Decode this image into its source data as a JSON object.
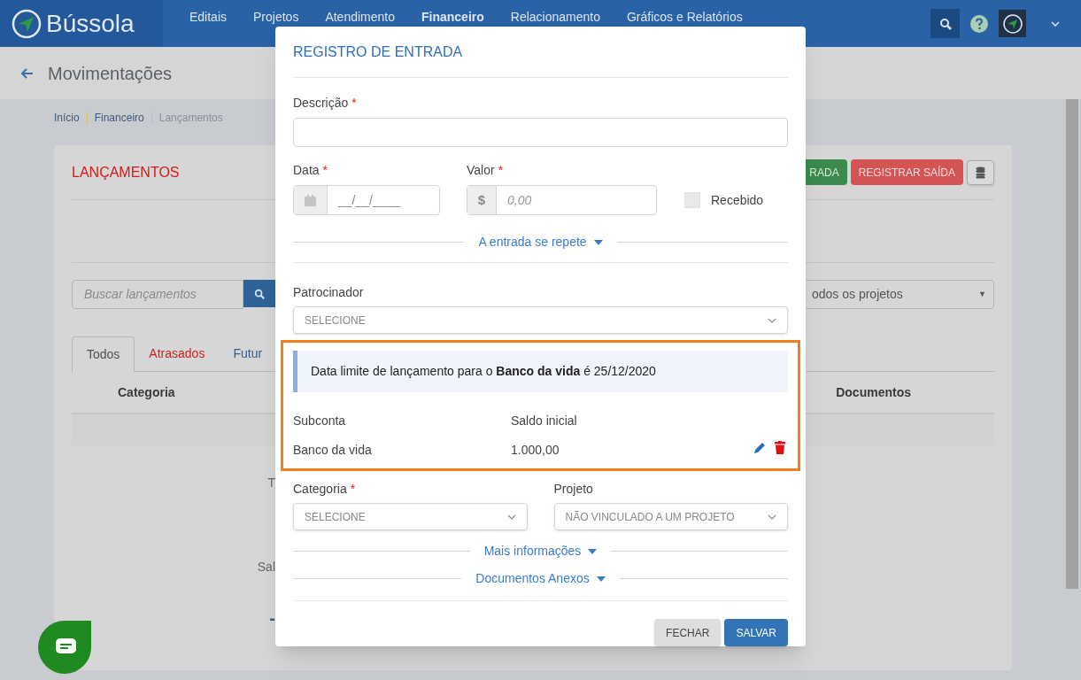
{
  "header": {
    "brand": "Bússola",
    "nav": [
      {
        "label": "Editais",
        "selected": false
      },
      {
        "label": "Projetos",
        "selected": false
      },
      {
        "label": "Atendimento",
        "selected": false
      },
      {
        "label": "Financeiro",
        "selected": true
      },
      {
        "label": "Relacionamento",
        "selected": false
      },
      {
        "label": "Gráficos e Relatórios",
        "selected": false
      }
    ]
  },
  "page_title": "Movimentações",
  "breadcrumb": [
    "Início",
    "Financeiro",
    "Lançamentos"
  ],
  "card": {
    "title": "LANÇAMENTOS",
    "buttons": [
      {
        "label": "RADA",
        "kind": "success"
      },
      {
        "label": "REGISTRAR SAÍDA",
        "kind": "danger"
      }
    ],
    "search": {
      "placeholder": "Buscar lançamentos"
    },
    "project_filter": {
      "value": "odos os projetos",
      "caret": "▼"
    },
    "tabs": [
      {
        "label": "Todos",
        "selected": true,
        "color": "#505050"
      },
      {
        "label": "Atrasados",
        "selected": false,
        "color": "#cc1f1f"
      },
      {
        "label": "Futur",
        "selected": false,
        "color": "#2e5f9a"
      }
    ],
    "columns": [
      "Categoria",
      "Documentos"
    ],
    "fragments": [
      {
        "text": "T",
        "kind": "label"
      },
      {
        "text": "Sal",
        "kind": "label"
      },
      {
        "text": "-",
        "kind": "amount"
      }
    ]
  },
  "modal": {
    "title": "REGISTRO DE ENTRADA",
    "required_mark": "*",
    "description": {
      "label": "Descrição",
      "required": true
    },
    "date": {
      "label": "Data",
      "required": true,
      "placeholder": "__/__/____"
    },
    "value": {
      "label": "Valor",
      "required": true,
      "prefix": "$",
      "placeholder": "0,00"
    },
    "received": {
      "label": "Recebido",
      "checked": false
    },
    "repeat": {
      "label": "A entrada se repete",
      "expanded": false
    },
    "sponsor": {
      "label": "Patrocinador",
      "placeholder": "SELECIONE"
    },
    "notice": "Data limite de lançamento para o **Banco da vida** é 25/12/2020",
    "subaccounts": {
      "columns": [
        "Subconta",
        "Saldo inicial"
      ],
      "rows": [
        [
          "Banco da vida",
          "1.000,00"
        ]
      ]
    },
    "category": {
      "label": "Categoria",
      "required": true,
      "placeholder": "SELECIONE"
    },
    "project": {
      "label": "Projeto",
      "required": false,
      "placeholder": "NÃO VINCULADO A UM PROJETO"
    },
    "sections": [
      {
        "label": "Mais informações",
        "expanded": false
      },
      {
        "label": "Documentos Anexos",
        "expanded": false
      }
    ],
    "buttons": [
      {
        "label": "FECHAR",
        "kind": "secondary"
      },
      {
        "label": "SALVAR",
        "kind": "primary"
      }
    ]
  }
}
